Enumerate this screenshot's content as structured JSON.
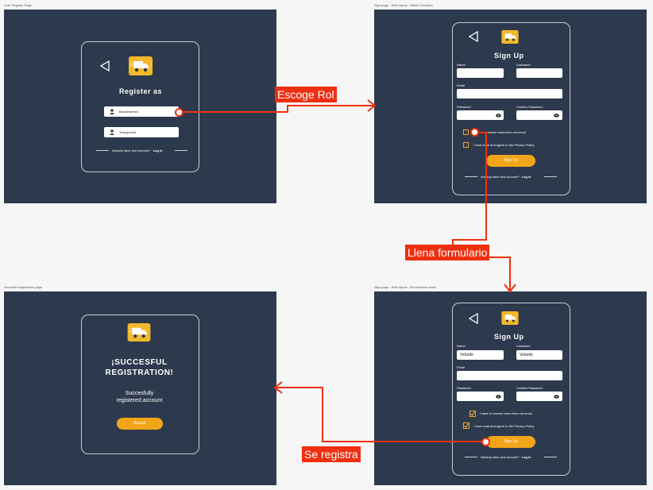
{
  "frames": {
    "f1_title": "User Register Page",
    "f2_title": "Sign page - Hide inputs - Blank Checkbox",
    "f3_title": "Succesful registration page",
    "f4_title": "Sign page - Hide inputs - Bk checkbox mark"
  },
  "role": {
    "heading": "Register as",
    "option_1": "Businessmen",
    "option_2": "Transportist",
    "footer_text": "Already have and account?",
    "footer_link": "Log In"
  },
  "signup": {
    "heading": "Sign Up",
    "name_label": "Name",
    "lastname_label": "Lastname",
    "email_label": "Email",
    "password_label": "Password",
    "confirm_label": "Confirm Password",
    "news_label": "I want to receive news from via email",
    "privacy_label": "I have read and agree to the Privacy Policy",
    "button": "Sign Up",
    "footer_text": "Already have and account?",
    "footer_link": "Log In",
    "name_value": "Velarde",
    "lastname_value": "Velarde"
  },
  "success": {
    "heading_1": "¡SUCCESFUL",
    "heading_2": "REGISTRATION!",
    "sub_1": "Succesfully",
    "sub_2": "registered account",
    "button": "Accept"
  },
  "flow": {
    "step_1": "Escoge Rol",
    "step_2": "Llena formulario",
    "step_3": "Se registra"
  },
  "colors": {
    "frame_bg": "#2d3a4d",
    "accent": "#f3a51a",
    "flow_red": "#ee2f10"
  },
  "icons": {
    "back": "back-triangle-icon",
    "logo": "delivery-truck-icon",
    "user": "user-icon",
    "eye": "eye-icon"
  }
}
